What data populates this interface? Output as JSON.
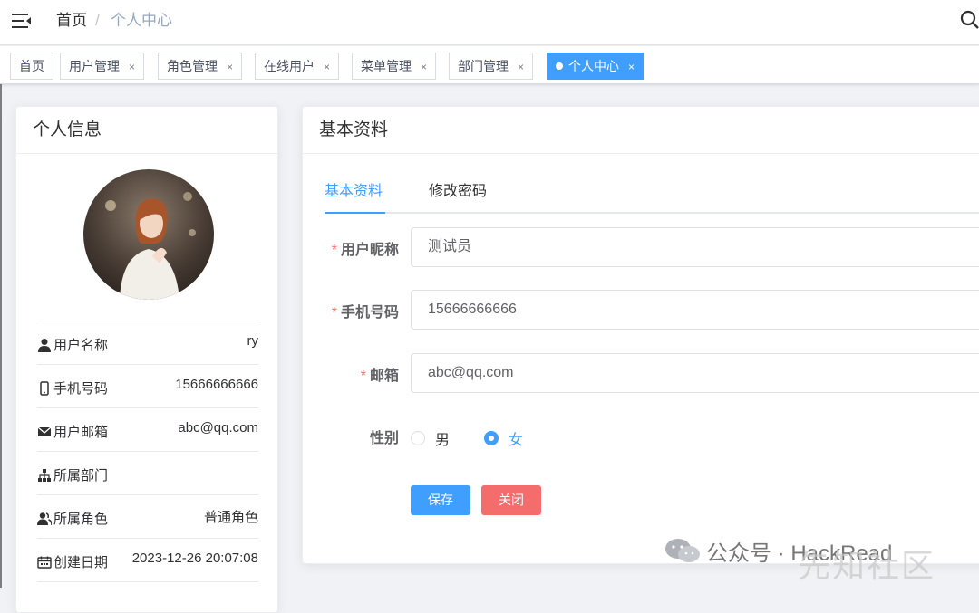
{
  "navbar": {
    "breadcrumb": [
      "首页",
      "个人中心"
    ],
    "separator": "/"
  },
  "tags": [
    {
      "label": "首页",
      "closable": false,
      "active": false
    },
    {
      "label": "用户管理",
      "closable": true,
      "active": false
    },
    {
      "label": "角色管理",
      "closable": true,
      "active": false
    },
    {
      "label": "在线用户",
      "closable": true,
      "active": false
    },
    {
      "label": "菜单管理",
      "closable": true,
      "active": false
    },
    {
      "label": "部门管理",
      "closable": true,
      "active": false
    },
    {
      "label": "个人中心",
      "closable": true,
      "active": true
    }
  ],
  "tag_close_glyph": "×",
  "profile": {
    "header": "个人信息",
    "rows": [
      {
        "label": "用户名称",
        "value": "ry",
        "icon": "user-icon"
      },
      {
        "label": "手机号码",
        "value": "15666666666",
        "icon": "phone-icon"
      },
      {
        "label": "用户邮箱",
        "value": "abc@qq.com",
        "icon": "mail-icon"
      },
      {
        "label": "所属部门",
        "value": "",
        "icon": "tree-icon"
      },
      {
        "label": "所属角色",
        "value": "普通角色",
        "icon": "peoples-icon"
      },
      {
        "label": "创建日期",
        "value": "2023-12-26 20:07:08",
        "icon": "date-icon"
      }
    ]
  },
  "basic": {
    "header": "基本资料",
    "tabs": [
      "基本资料",
      "修改密码"
    ],
    "active_tab": 0,
    "fields": {
      "nickname": {
        "label": "用户昵称",
        "value": "测试员",
        "required": true
      },
      "phone": {
        "label": "手机号码",
        "value": "15666666666",
        "required": true
      },
      "email": {
        "label": "邮箱",
        "value": "abc@qq.com",
        "required": true
      }
    },
    "gender": {
      "label": "性别",
      "options": [
        "男",
        "女"
      ],
      "selected": "女"
    },
    "required_mark": "*",
    "save_label": "保存",
    "close_label": "关闭"
  },
  "watermark": {
    "brand": "公众号 · HackRead",
    "site": "先知社区"
  },
  "colors": {
    "primary": "#409eff",
    "danger": "#f56c6c"
  }
}
